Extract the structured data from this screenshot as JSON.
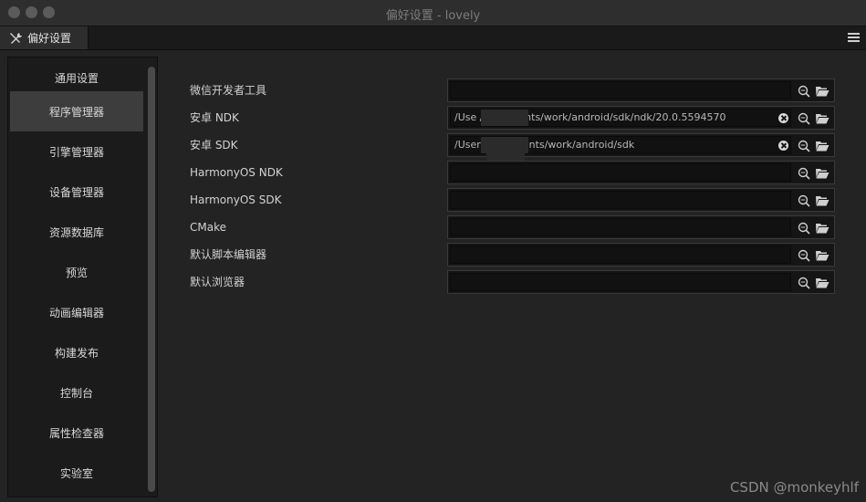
{
  "window": {
    "title": "偏好设置 - lovely"
  },
  "tab": {
    "label": "偏好设置",
    "icon": "tools-icon"
  },
  "menu": {
    "icon": "hamburger-menu-icon"
  },
  "sidebar": {
    "items": [
      {
        "label": "通用设置",
        "active": false
      },
      {
        "label": "程序管理器",
        "active": true
      },
      {
        "label": "引擎管理器",
        "active": false
      },
      {
        "label": "设备管理器",
        "active": false
      },
      {
        "label": "资源数据库",
        "active": false
      },
      {
        "label": "预览",
        "active": false
      },
      {
        "label": "动画编辑器",
        "active": false
      },
      {
        "label": "构建发布",
        "active": false
      },
      {
        "label": "控制台",
        "active": false
      },
      {
        "label": "属性检查器",
        "active": false
      },
      {
        "label": "实验室",
        "active": false
      }
    ]
  },
  "main": {
    "rows": [
      {
        "label": "微信开发者工具",
        "value": "",
        "clearable": false
      },
      {
        "label": "安卓 NDK",
        "value": "/Use            /Documents/work/android/sdk/ndk/20.0.5594570",
        "clearable": true
      },
      {
        "label": "安卓 SDK",
        "value": "/User            /Documents/work/android/sdk",
        "clearable": true
      },
      {
        "label": "HarmonyOS NDK",
        "value": "",
        "clearable": false
      },
      {
        "label": "HarmonyOS SDK",
        "value": "",
        "clearable": false
      },
      {
        "label": "CMake",
        "value": "",
        "clearable": false
      },
      {
        "label": "默认脚本编辑器",
        "value": "",
        "clearable": false
      },
      {
        "label": "默认浏览器",
        "value": "",
        "clearable": false
      }
    ]
  },
  "watermark": "CSDN @monkeyhlf",
  "colors": {
    "active_item": "#3d3d3d",
    "background": "#232323"
  }
}
